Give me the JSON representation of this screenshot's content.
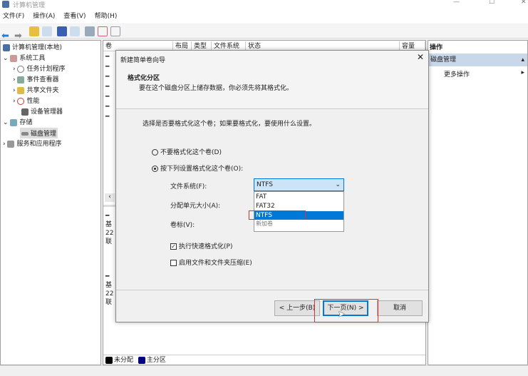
{
  "window": {
    "title": "计算机管理",
    "minimize": "—",
    "maximize": "☐",
    "close": "✕"
  },
  "menu": [
    "文件(F)",
    "操作(A)",
    "查看(V)",
    "帮助(H)"
  ],
  "tree": {
    "root": "计算机管理(本地)",
    "system_tools": "系统工具",
    "task_scheduler": "任务计划程序",
    "event_viewer": "事件查看器",
    "shared_folders": "共享文件夹",
    "performance": "性能",
    "device_manager": "设备管理器",
    "storage": "存储",
    "disk_management": "磁盘管理",
    "services": "服务和应用程序"
  },
  "columns": [
    "卷",
    "布局",
    "类型",
    "文件系统",
    "状态",
    "容量"
  ],
  "disks": [
    {
      "l1": "基",
      "l2": "22",
      "l3": "联"
    },
    {
      "l1": "基",
      "l2": "22",
      "l3": "联"
    }
  ],
  "legend": {
    "unallocated": "未分配",
    "primary": "主分区",
    "unallocated_color": "#000000",
    "primary_color": "#000080"
  },
  "actions": {
    "header": "操作",
    "section": "磁盘管理",
    "more": "更多操作"
  },
  "dialog": {
    "title": "新建简单卷向导",
    "heading": "格式化分区",
    "subheading": "要在这个磁盘分区上储存数据，你必须先将其格式化。",
    "question": "选择是否要格式化这个卷；如果要格式化，要使用什么设置。",
    "opt_no": "不要格式化这个卷(D)",
    "opt_yes": "按下列设置格式化这个卷(O):",
    "fs_label": "文件系统(F):",
    "fs_value": "NTFS",
    "fs_options": [
      "FAT",
      "FAT32",
      "NTFS"
    ],
    "alloc_label": "分配单元大小(A):",
    "vol_label": "卷标(V):",
    "vol_value": "新加卷",
    "quick_format": "执行快速格式化(P)",
    "compression": "启用文件和文件夹压缩(E)",
    "back": "< 上一步(B)",
    "next": "下一页(N) >",
    "cancel": "取消",
    "close": "✕"
  }
}
